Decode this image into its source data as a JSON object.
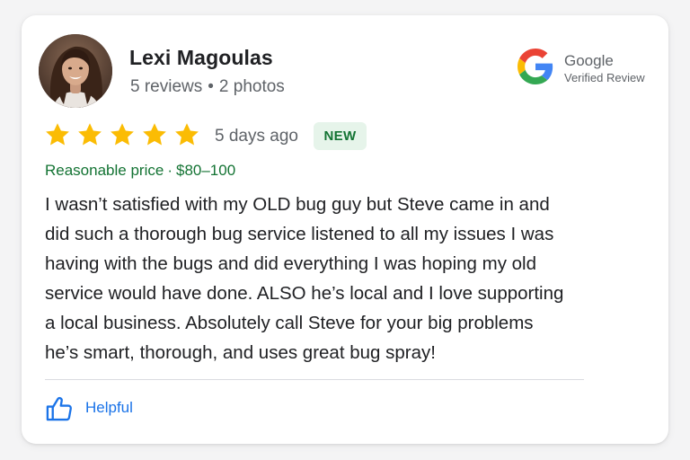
{
  "reviewer": {
    "name": "Lexi Magoulas",
    "reviews": "5 reviews",
    "separator": "•",
    "photos": "2 photos",
    "avatar_icon": "reviewer-photo"
  },
  "badge": {
    "brand": "Google",
    "subtitle": "Verified Review",
    "icon": "google-g-logo"
  },
  "rating": {
    "stars": 5,
    "max": 5,
    "star_color": "#FBBC04",
    "date": "5 days ago",
    "new_label": "NEW"
  },
  "price": {
    "label": "Reasonable price",
    "separator": "·",
    "range": "$80–100",
    "color": "#137333"
  },
  "review": {
    "text": "I wasn’t satisfied with my OLD bug guy but Steve came in and\ndid such a thorough bug service listened to all my issues I was\nhaving with the bugs and did everything I was hoping my old\nservice would have done. ALSO he’s local and I love supporting\na local business. Absolutely call Steve for your big problems\nhe’s smart, thorough, and uses great bug spray!"
  },
  "actions": {
    "helpful_label": "Helpful",
    "helpful_icon": "thumbs-up-icon",
    "accent": "#1a73e8"
  }
}
